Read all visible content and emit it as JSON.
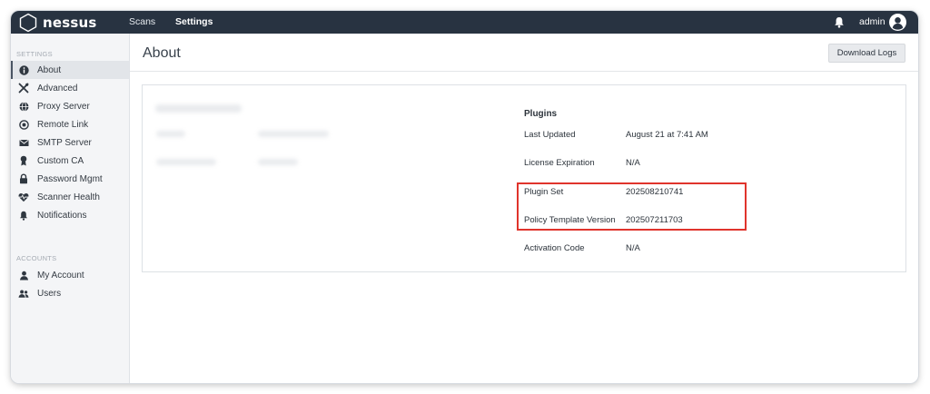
{
  "app": {
    "logo_text": "nessus"
  },
  "topnav": {
    "scans": "Scans",
    "settings": "Settings"
  },
  "user": {
    "name": "admin"
  },
  "sidebar": {
    "settings_heading": "SETTINGS",
    "settings_items": [
      {
        "label": "About",
        "icon": "info-icon",
        "active": true
      },
      {
        "label": "Advanced",
        "icon": "tools-icon"
      },
      {
        "label": "Proxy Server",
        "icon": "globe-icon"
      },
      {
        "label": "Remote Link",
        "icon": "remote-link-icon"
      },
      {
        "label": "SMTP Server",
        "icon": "envelope-icon"
      },
      {
        "label": "Custom CA",
        "icon": "certificate-icon"
      },
      {
        "label": "Password Mgmt",
        "icon": "lock-icon"
      },
      {
        "label": "Scanner Health",
        "icon": "heart-pulse-icon"
      },
      {
        "label": "Notifications",
        "icon": "bell-icon"
      }
    ],
    "accounts_heading": "ACCOUNTS",
    "accounts_items": [
      {
        "label": "My Account",
        "icon": "user-icon"
      },
      {
        "label": "Users",
        "icon": "users-icon"
      }
    ]
  },
  "page": {
    "title": "About",
    "download_logs": "Download Logs"
  },
  "plugins": {
    "title": "Plugins",
    "rows": [
      {
        "label": "Last Updated",
        "value": "August 21 at 7:41 AM"
      },
      {
        "label": "License Expiration",
        "value": "N/A"
      },
      {
        "label": "Plugin Set",
        "value": "202508210741"
      },
      {
        "label": "Policy Template Version",
        "value": "202507211703"
      },
      {
        "label": "Activation Code",
        "value": "N/A"
      }
    ]
  },
  "colors": {
    "topbar": "#283341",
    "highlight": "#e0342c"
  }
}
